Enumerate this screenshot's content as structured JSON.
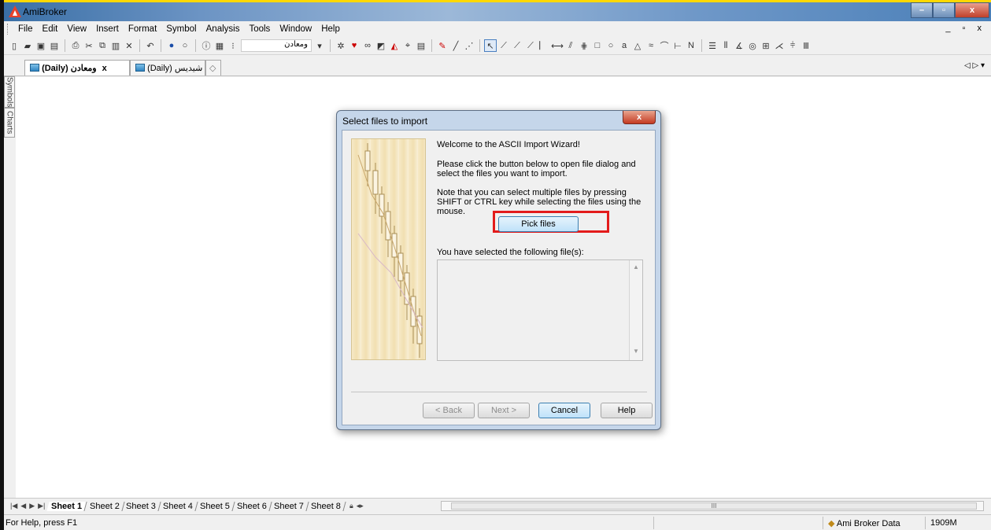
{
  "app": {
    "title": "AmiBroker",
    "window_controls": [
      "–",
      "▫",
      "x"
    ],
    "mdi_controls": "_ ▫ x"
  },
  "menu": [
    "File",
    "Edit",
    "View",
    "Insert",
    "Format",
    "Symbol",
    "Analysis",
    "Tools",
    "Window",
    "Help"
  ],
  "toolbar": {
    "symbol_combo": "ومعادن"
  },
  "doc_tabs": [
    {
      "label": "(Daily) ومعادن",
      "close": "x"
    },
    {
      "label": "(Daily) شیدیس"
    }
  ],
  "side_tabs": [
    "Symbols",
    "Charts"
  ],
  "sheets": [
    "Sheet 1",
    "Sheet 2",
    "Sheet 3",
    "Sheet 4",
    "Sheet 5",
    "Sheet 6",
    "Sheet 7",
    "Sheet 8"
  ],
  "active_sheet": "Sheet 1",
  "scroll_thumb": "III",
  "status": {
    "help": "For Help, press F1",
    "datasource": "Ami Broker Data",
    "memory": "1909M"
  },
  "dialog": {
    "title": "Select files to import",
    "close": "x",
    "welcome": "Welcome to the ASCII Import Wizard!",
    "instruction": "Please click the button below to open file dialog and select the files you want to import.",
    "note": "Note that you can select multiple files by pressing SHIFT or CTRL key while selecting the files using the mouse.",
    "pick_button": "Pick files",
    "selected_label": "You have selected the following file(s):",
    "back": "< Back",
    "next": "Next >",
    "cancel": "Cancel",
    "help": "Help"
  }
}
